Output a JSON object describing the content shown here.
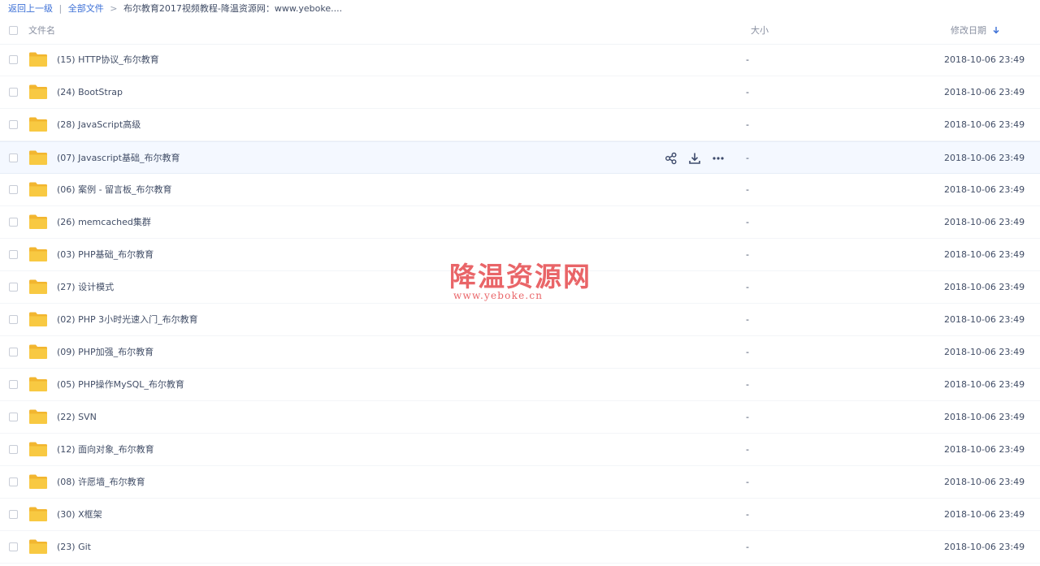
{
  "breadcrumb": {
    "back": "返回上一级",
    "divider": "|",
    "all_files": "全部文件",
    "arrow": ">",
    "current": "布尔教育2017视频教程-降温资源网：www.yeboke...."
  },
  "columns": {
    "name": "文件名",
    "size": "大小",
    "date": "修改日期",
    "sort_icon": "arrow-down-icon"
  },
  "colors": {
    "folder": "#f8c942",
    "link": "#3b6fd6",
    "action_icon": "#3d4a6b",
    "watermark": "#e8585c"
  },
  "hover_actions": [
    "share-icon",
    "download-icon",
    "more-icon"
  ],
  "files": [
    {
      "name": "(15) HTTP协议_布尔教育",
      "size": "-",
      "date": "2018-10-06 23:49"
    },
    {
      "name": "(24) BootStrap",
      "size": "-",
      "date": "2018-10-06 23:49"
    },
    {
      "name": "(28) JavaScript高级",
      "size": "-",
      "date": "2018-10-06 23:49"
    },
    {
      "name": "(07) Javascript基础_布尔教育",
      "size": "-",
      "date": "2018-10-06 23:49"
    },
    {
      "name": "(06) 案例 - 留言板_布尔教育",
      "size": "-",
      "date": "2018-10-06 23:49"
    },
    {
      "name": "(26) memcached集群",
      "size": "-",
      "date": "2018-10-06 23:49"
    },
    {
      "name": "(03) PHP基础_布尔教育",
      "size": "-",
      "date": "2018-10-06 23:49"
    },
    {
      "name": "(27) 设计模式",
      "size": "-",
      "date": "2018-10-06 23:49"
    },
    {
      "name": "(02) PHP 3小时光速入门_布尔教育",
      "size": "-",
      "date": "2018-10-06 23:49"
    },
    {
      "name": "(09) PHP加强_布尔教育",
      "size": "-",
      "date": "2018-10-06 23:49"
    },
    {
      "name": "(05) PHP操作MySQL_布尔教育",
      "size": "-",
      "date": "2018-10-06 23:49"
    },
    {
      "name": "(22) SVN",
      "size": "-",
      "date": "2018-10-06 23:49"
    },
    {
      "name": "(12) 面向对象_布尔教育",
      "size": "-",
      "date": "2018-10-06 23:49"
    },
    {
      "name": "(08) 许愿墙_布尔教育",
      "size": "-",
      "date": "2018-10-06 23:49"
    },
    {
      "name": "(30) X框架",
      "size": "-",
      "date": "2018-10-06 23:49"
    },
    {
      "name": "(23) Git",
      "size": "-",
      "date": "2018-10-06 23:49"
    }
  ],
  "hover_row_index": 3,
  "watermark": {
    "main": "降温资源网",
    "sub": "www.yeboke.cn"
  }
}
